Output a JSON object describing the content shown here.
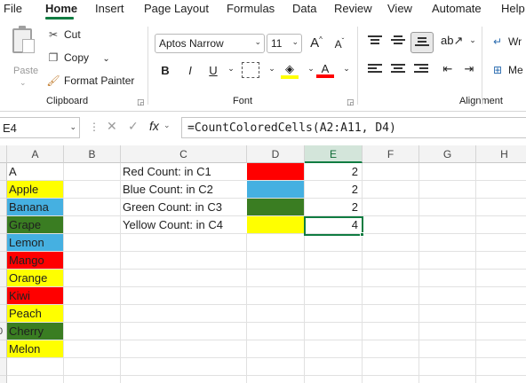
{
  "menu": {
    "tabs": [
      "File",
      "Home",
      "Insert",
      "Page Layout",
      "Formulas",
      "Data",
      "Review",
      "View",
      "Automate",
      "Help"
    ]
  },
  "ribbon": {
    "clipboard": {
      "paste": "Paste",
      "cut": "Cut",
      "copy": "Copy",
      "format_painter": "Format Painter",
      "label": "Clipboard"
    },
    "font": {
      "name": "Aptos Narrow",
      "size": "11",
      "bold": "B",
      "italic": "I",
      "underline": "U",
      "label": "Font",
      "fill_color": "#ffff00",
      "font_color": "#ff0000"
    },
    "alignment": {
      "wrap_text": "Wr",
      "merge": "Me",
      "label": "Alignment"
    }
  },
  "formula_bar": {
    "name_box": "E4",
    "formula": "=CountColoredCells(A2:A11, D4)"
  },
  "grid": {
    "columns": [
      "A",
      "B",
      "C",
      "D",
      "E",
      "F",
      "G",
      "H"
    ],
    "selected_column": "E",
    "column_a": [
      {
        "text": "A",
        "color": "#ffffff"
      },
      {
        "text": "Apple",
        "color": "#ffff00"
      },
      {
        "text": "Banana",
        "color": "#45b0e1"
      },
      {
        "text": "Grape",
        "color": "#3a7d22"
      },
      {
        "text": "Lemon",
        "color": "#45b0e1"
      },
      {
        "text": "Mango",
        "color": "#ff0000"
      },
      {
        "text": "Orange",
        "color": "#ffff00"
      },
      {
        "text": "Kiwi",
        "color": "#ff0000"
      },
      {
        "text": "Peach",
        "color": "#ffff00"
      },
      {
        "text": "Cherry",
        "color": "#3a7d22"
      },
      {
        "text": "Melon",
        "color": "#ffff00"
      }
    ],
    "column_c": [
      "Red Count: in C1",
      "Blue Count: in C2",
      "Green Count: in C3",
      "Yellow Count: in C4"
    ],
    "column_d_colors": [
      "#ff0000",
      "#45b0e1",
      "#3a7d22",
      "#ffff00"
    ],
    "column_e": [
      "2",
      "2",
      "2",
      "4"
    ],
    "partial_row_labels": [
      "0"
    ]
  },
  "accent_color": "#107c41"
}
